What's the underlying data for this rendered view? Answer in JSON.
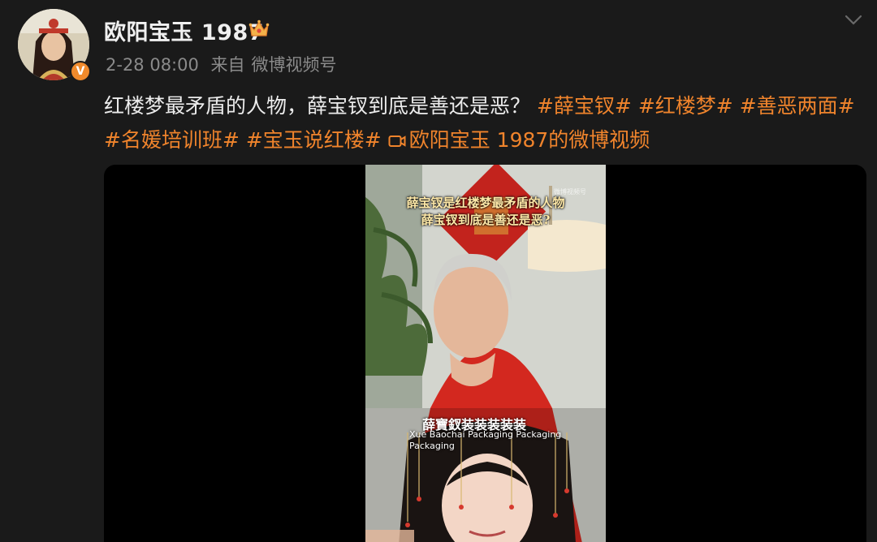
{
  "user": {
    "name": "欧阳宝玉 1987",
    "verified_badge": "V",
    "badge_icon": "crown-icon",
    "avatar_icon": "avatar-portrait"
  },
  "meta": {
    "time": "2-28 08:00",
    "source_prefix": "来自",
    "source": "微博视频号"
  },
  "post": {
    "text": "红楼梦最矛盾的人物，薛宝钗到底是善还是恶？",
    "tags": [
      "#薛宝钗#",
      "#红楼梦#",
      "#善恶两面#",
      "#名媛培训班#",
      "#宝玉说红楼#"
    ],
    "video_link": "欧阳宝玉 1987的微博视频"
  },
  "video": {
    "caption_line1": "薛宝钗是红楼梦最矛盾的人物",
    "caption_line2": "薛宝钗到底是善还是恶?",
    "watermark": "微博视频号",
    "subtitle_cn": "薛寶釵装装装装装",
    "subtitle_en": "Xue Baochai Packaging Packaging Packaging"
  },
  "colors": {
    "background": "#1a1a1a",
    "accent": "#f0842c",
    "meta": "#8a8a8a"
  }
}
